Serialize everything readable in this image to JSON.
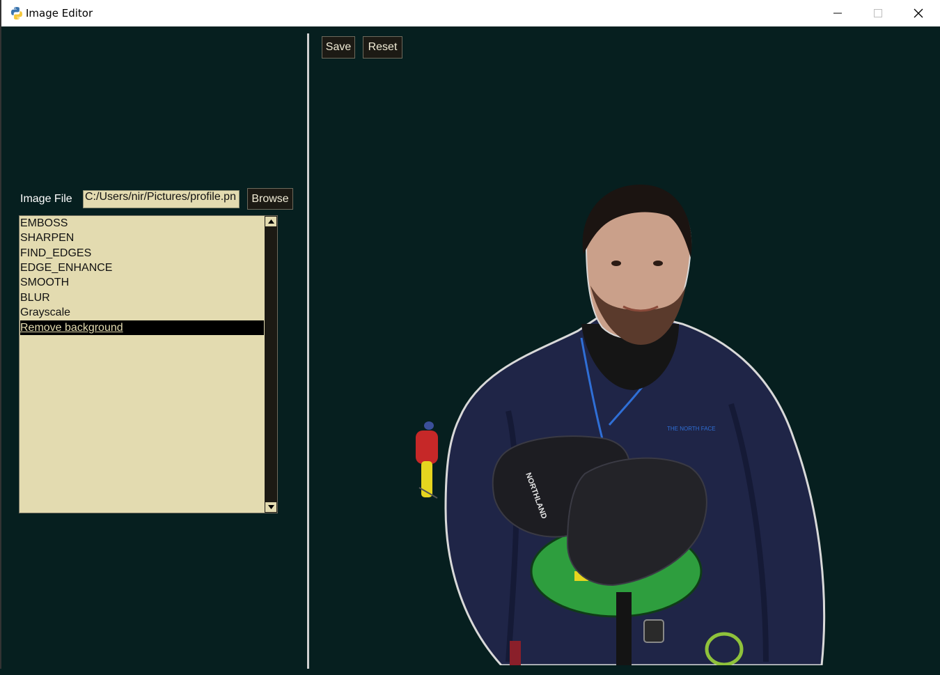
{
  "window": {
    "title": "Image Editor",
    "icon": "python-icon"
  },
  "controls": {
    "image_file_label": "Image File",
    "image_file_value": "C:/Users/nir/Pictures/profile.pn",
    "browse_label": "Browse",
    "save_label": "Save",
    "reset_label": "Reset"
  },
  "filters": {
    "items": [
      "EMBOSS",
      "SHARPEN",
      "FIND_EDGES",
      "EDGE_ENHANCE",
      "SMOOTH",
      "BLUR",
      "Grayscale",
      "Remove background"
    ],
    "selected": "Remove background"
  },
  "preview": {
    "jacket_logo": "THE NORTH FACE",
    "glove_text": "NORTHLAND"
  },
  "colors": {
    "background": "#061f1f",
    "field": "#e3dbb0",
    "button": "#1c1a14"
  }
}
